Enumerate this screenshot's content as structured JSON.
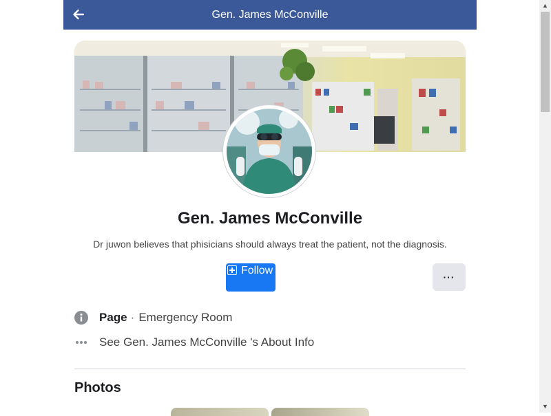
{
  "header": {
    "title": "Gen. James McConville",
    "back_icon": "arrow-left-icon"
  },
  "profile": {
    "name": "Gen. James McConville",
    "bio": "Dr juwon believes that phisicians should always treat the patient, not the diagnosis."
  },
  "actions": {
    "follow_label": "Follow",
    "more_label": "···"
  },
  "info": {
    "page_label": "Page",
    "separator": "·",
    "category": "Emergency Room",
    "about_text": "See Gen. James McConville 's About Info"
  },
  "photos": {
    "title": "Photos"
  },
  "colors": {
    "header_bg": "#3b5998",
    "accent": "#1877f2",
    "secondary_button": "#e4e6eb"
  }
}
